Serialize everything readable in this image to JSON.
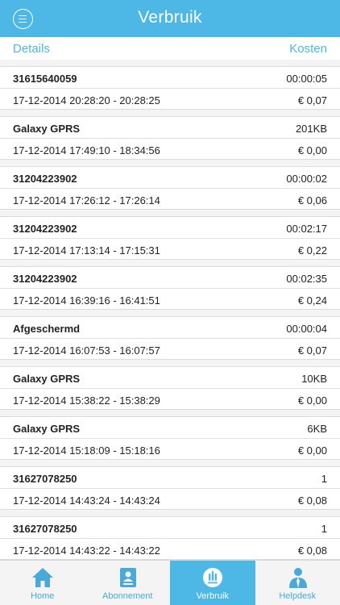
{
  "header": {
    "title": "Verbruik"
  },
  "columns": {
    "left": "Details",
    "right": "Kosten"
  },
  "entries": [
    {
      "name": "31615640059",
      "amount": "00:00:05",
      "time": "17-12-2014 20:28:20 - 20:28:25",
      "cost": "€ 0,07"
    },
    {
      "name": "Galaxy GPRS",
      "amount": "201KB",
      "time": "17-12-2014 17:49:10 - 18:34:56",
      "cost": "€ 0,00"
    },
    {
      "name": "31204223902",
      "amount": "00:00:02",
      "time": "17-12-2014 17:26:12 - 17:26:14",
      "cost": "€ 0,06"
    },
    {
      "name": "31204223902",
      "amount": "00:02:17",
      "time": "17-12-2014 17:13:14 - 17:15:31",
      "cost": "€ 0,22"
    },
    {
      "name": "31204223902",
      "amount": "00:02:35",
      "time": "17-12-2014 16:39:16 - 16:41:51",
      "cost": "€ 0,24"
    },
    {
      "name": "Afgeschermd",
      "amount": "00:00:04",
      "time": "17-12-2014 16:07:53 - 16:07:57",
      "cost": "€ 0,07"
    },
    {
      "name": "Galaxy GPRS",
      "amount": "10KB",
      "time": "17-12-2014 15:38:22 - 15:38:29",
      "cost": "€ 0,00"
    },
    {
      "name": "Galaxy GPRS",
      "amount": "6KB",
      "time": "17-12-2014 15:18:09 - 15:18:16",
      "cost": "€ 0,00"
    },
    {
      "name": "31627078250",
      "amount": "1",
      "time": "17-12-2014 14:43:24 - 14:43:24",
      "cost": "€ 0,08"
    },
    {
      "name": "31627078250",
      "amount": "1",
      "time": "17-12-2014 14:43:22 - 14:43:22",
      "cost": "€ 0,08"
    }
  ],
  "tabs": [
    {
      "label": "Home",
      "icon": "home-icon"
    },
    {
      "label": "Abonnement",
      "icon": "contract-icon"
    },
    {
      "label": "Verbruik",
      "icon": "usage-icon",
      "active": true
    },
    {
      "label": "Helpdesk",
      "icon": "support-agent-icon"
    }
  ],
  "colors": {
    "accent": "#4db8e6",
    "tab_icon": "#4aa9d8",
    "list_bg": "#f4f4f5"
  }
}
